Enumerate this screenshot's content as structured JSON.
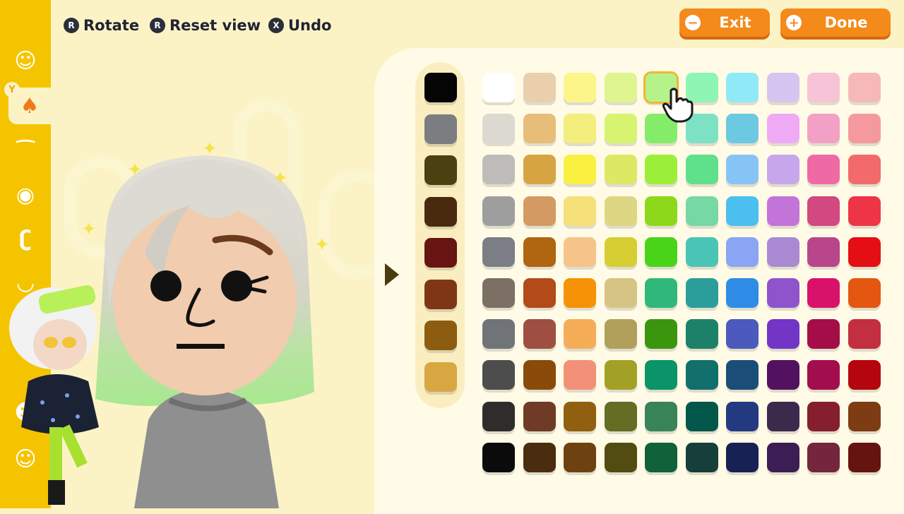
{
  "top_hints": [
    {
      "glyph": "R",
      "label": "Rotate"
    },
    {
      "glyph": "R",
      "label": "Reset view"
    },
    {
      "glyph": "X",
      "label": "Undo"
    }
  ],
  "buttons": {
    "exit_label": "Exit",
    "done_label": "Done",
    "exit_glyph": "−",
    "done_glyph": "+"
  },
  "sidebar": {
    "active_hint": "Y",
    "categories": [
      {
        "icon": "face-icon",
        "glyph": "☺"
      },
      {
        "icon": "hair-icon",
        "glyph": "♠"
      },
      {
        "icon": "eyebrows-icon",
        "glyph": "⁀"
      },
      {
        "icon": "eyes-icon",
        "glyph": "◉"
      },
      {
        "icon": "nose-icon",
        "glyph": "ʗ"
      },
      {
        "icon": "mouth-icon",
        "glyph": "◡"
      },
      {
        "icon": "glasses-icon",
        "glyph": "∞"
      },
      {
        "icon": "beard-icon",
        "glyph": "☻"
      },
      {
        "icon": "body-icon",
        "glyph": "☺"
      }
    ]
  },
  "palette": {
    "selected_color": "#b6f28a",
    "strip_colors": [
      "#050505",
      "#7b7d80",
      "#4a4010",
      "#4a2a0e",
      "#681413",
      "#7e3614",
      "#8c5c10",
      "#d9a742"
    ],
    "grid": [
      [
        "#ffffff",
        "#e9cfac",
        "#fbf58a",
        "#dff590",
        "#b6f28a",
        "#8ef5b4",
        "#8fe9f7",
        "#d6c5f0",
        "#f7c3d6",
        "#f7b8b8"
      ],
      [
        "#dcdad0",
        "#e8bd79",
        "#f4ee7e",
        "#d6f470",
        "#85ec6a",
        "#7de2c4",
        "#6dc9e1",
        "#eeaaf4",
        "#f3a0c6",
        "#f49a9e"
      ],
      [
        "#bdbcb8",
        "#d6a441",
        "#faf040",
        "#dce964",
        "#9cef39",
        "#5fe08a",
        "#86c4f5",
        "#c6a7eb",
        "#ef6aa4",
        "#f26a6a"
      ],
      [
        "#9e9e9e",
        "#d49a64",
        "#f5e07a",
        "#ddd784",
        "#8ed81c",
        "#76d8a4",
        "#4bbff0",
        "#c274d8",
        "#d24880",
        "#ee3547"
      ],
      [
        "#7c7e85",
        "#b06510",
        "#f6c388",
        "#d6ce32",
        "#49d41a",
        "#4ac5b5",
        "#89a5f3",
        "#a98ad2",
        "#b9468a",
        "#e30f14"
      ],
      [
        "#7b7063",
        "#b24a1a",
        "#f59206",
        "#d5c483",
        "#2fb87a",
        "#2b9e9c",
        "#2e8ce6",
        "#8f54cc",
        "#d8126a",
        "#e45710"
      ],
      [
        "#707479",
        "#9e4f42",
        "#f5ad58",
        "#b0a05c",
        "#3b960e",
        "#1d8169",
        "#4b5abc",
        "#7235c6",
        "#a50d48",
        "#c22f40"
      ],
      [
        "#4d4d4d",
        "#894a0a",
        "#f39178",
        "#a2a126",
        "#0b9468",
        "#11706c",
        "#1a4e78",
        "#521260",
        "#a20d4d",
        "#b5050d"
      ],
      [
        "#2f2d2b",
        "#6f3a26",
        "#915f10",
        "#636d24",
        "#388458",
        "#03574a",
        "#243a80",
        "#3c2a4c",
        "#851f30",
        "#7e3c14"
      ],
      [
        "#0b0b0b",
        "#4a2c0f",
        "#6e4210",
        "#524c12",
        "#11613a",
        "#163e3a",
        "#182154",
        "#3a1e54",
        "#75263c",
        "#651410"
      ]
    ]
  }
}
